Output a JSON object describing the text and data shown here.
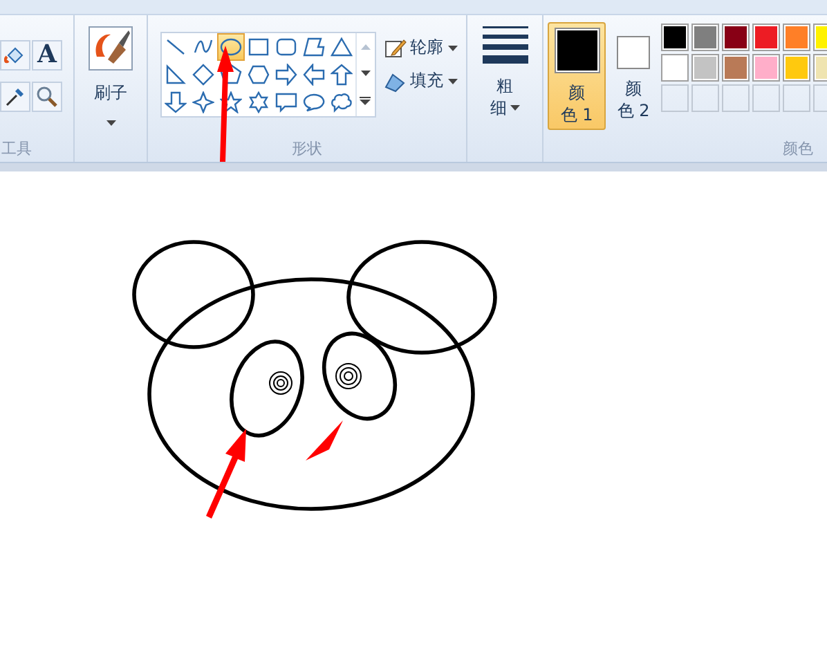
{
  "tools": {
    "label": "工具",
    "text_tool": "A"
  },
  "brush": {
    "label": "刷子"
  },
  "shapes": {
    "label": "形状",
    "items": [
      {
        "kind": "line",
        "selected": false
      },
      {
        "kind": "curve",
        "selected": false
      },
      {
        "kind": "oval",
        "selected": true
      },
      {
        "kind": "rect",
        "selected": false
      },
      {
        "kind": "roundrect",
        "selected": false
      },
      {
        "kind": "polygon",
        "selected": false
      },
      {
        "kind": "triangle",
        "selected": false
      },
      {
        "kind": "right-triangle",
        "selected": false
      },
      {
        "kind": "diamond",
        "selected": false
      },
      {
        "kind": "pentagon",
        "selected": false
      },
      {
        "kind": "hexagon",
        "selected": false
      },
      {
        "kind": "arrow-right",
        "selected": false
      },
      {
        "kind": "arrow-left",
        "selected": false
      },
      {
        "kind": "arrow-up",
        "selected": false
      },
      {
        "kind": "arrow-down",
        "selected": false
      },
      {
        "kind": "star4",
        "selected": false
      },
      {
        "kind": "star5",
        "selected": false
      },
      {
        "kind": "star6",
        "selected": false
      },
      {
        "kind": "callout-rect",
        "selected": false
      },
      {
        "kind": "callout-oval",
        "selected": false
      },
      {
        "kind": "callout-cloud",
        "selected": false
      }
    ],
    "outline": "轮廓",
    "fill": "填充"
  },
  "thickness": {
    "label_top": "粗",
    "label_bottom": "细"
  },
  "colors": {
    "label": "颜色",
    "color1": {
      "label_top": "颜",
      "label_bottom": "色 1",
      "color": "#000000",
      "selected": true
    },
    "color2": {
      "label_top": "颜",
      "label_bottom": "色 2",
      "color": "#ffffff",
      "selected": false
    },
    "swatches": [
      {
        "color": "#000000"
      },
      {
        "color": "#7f7f7f"
      },
      {
        "color": "#880015"
      },
      {
        "color": "#ed1c24"
      },
      {
        "color": "#ff7f27"
      },
      {
        "color": "#fff200"
      },
      {
        "color": "#ffffff"
      },
      {
        "color": "#c3c3c3"
      },
      {
        "color": "#b97a57"
      },
      {
        "color": "#ffaec9"
      },
      {
        "color": "#ffc90e"
      },
      {
        "color": "#efe4b0"
      }
    ],
    "custom_slots": [
      {
        "filled": false
      },
      {
        "filled": false
      },
      {
        "filled": false
      },
      {
        "filled": false
      },
      {
        "filled": false
      },
      {
        "filled": false
      }
    ]
  }
}
